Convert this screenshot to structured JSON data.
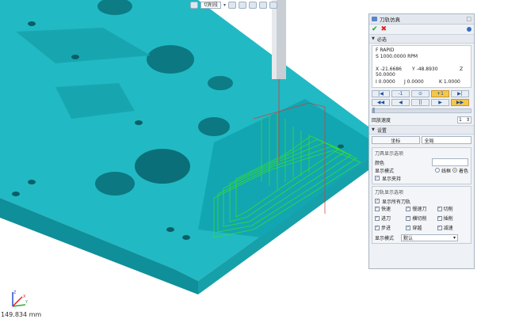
{
  "toolbar": {
    "dropdown_value": "切削段"
  },
  "panel": {
    "title": "刀轨仿真",
    "section_required": "必选",
    "info": {
      "line1": "F   RAPID",
      "line2": "S 1000.0000 RPM",
      "x": "X  -21.6686",
      "y": "Y   -48.8930",
      "z": "Z",
      "z_value": "50.0000",
      "i": "I  0.0000",
      "j": "J  0.0000",
      "k": "K   1.0000"
    },
    "controls_row1": [
      "|◀",
      "-1",
      "⊙",
      "+1",
      "▶|"
    ],
    "controls_row2": [
      "◀◀",
      "◀",
      "||",
      "▶",
      "▶▶"
    ],
    "speed_label": "回放速度",
    "speed_value": "1",
    "section_settings": "设置",
    "coord_button": "坐标",
    "coord_value": "全局",
    "tool_display": {
      "title": "刀具显示选项",
      "color_label": "颜色",
      "mode_label": "显示模式",
      "wireframe_label": "线框",
      "shaded_label": "着色",
      "show_holder_label": "显示夹持"
    },
    "path_display": {
      "title": "刀轨显示选项",
      "show_all_label": "显示所有刀轨",
      "items": [
        "快速",
        "慢速刀",
        "切削",
        "进刀",
        "横切削",
        "插削",
        "步进",
        "穿越",
        "减速"
      ],
      "mode_label": "显示模式",
      "mode_value": "默认"
    }
  },
  "status": {
    "coord_readout": "149.834 mm"
  },
  "colors": {
    "part": "#1fb7c2",
    "part_dark": "#138a94",
    "toolpath": "#39e028",
    "ok": "#1f9d2c",
    "cancel": "#dd2222",
    "highlight": "#f5c84a"
  }
}
